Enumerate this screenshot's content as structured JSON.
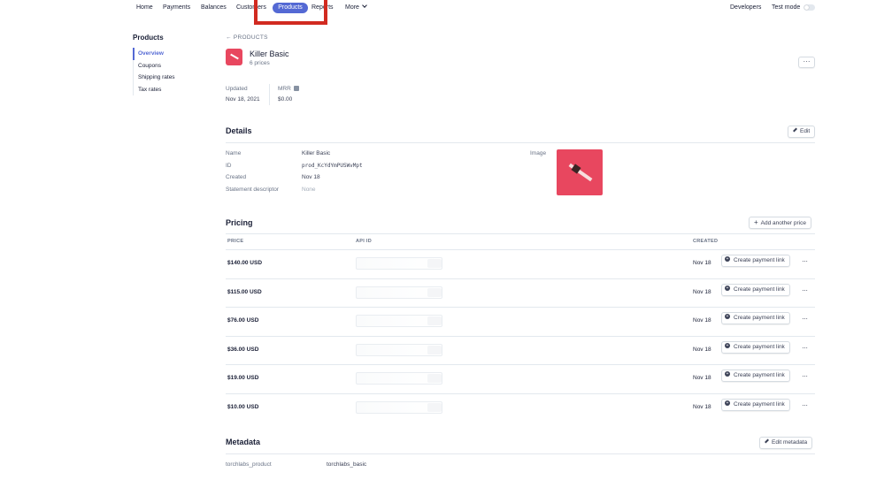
{
  "nav": {
    "items": [
      "Home",
      "Payments",
      "Balances",
      "Customers",
      "Products",
      "Reports",
      "More"
    ],
    "developers": "Developers",
    "test_mode": "Test mode"
  },
  "sidebar": {
    "title": "Products",
    "items": [
      {
        "label": "Overview",
        "active": true
      },
      {
        "label": "Coupons",
        "active": false
      },
      {
        "label": "Shipping rates",
        "active": false
      },
      {
        "label": "Tax rates",
        "active": false
      }
    ]
  },
  "product": {
    "back_label": "← PRODUCTS",
    "name": "Killer Basic",
    "prices_count": "6 prices",
    "more": "···",
    "updated_label": "Updated",
    "updated_value": "Nov 18, 2021",
    "mrr_label": "MRR",
    "mrr_value": "$0.00"
  },
  "details": {
    "title": "Details",
    "edit_label": "Edit",
    "name_label": "Name",
    "name_value": "Killer Basic",
    "id_label": "ID",
    "id_value": "prod_KcYdYmPUSWvMpt",
    "created_label": "Created",
    "created_value": "Nov 18",
    "descriptor_label": "Statement descriptor",
    "descriptor_value": "None",
    "image_label": "Image"
  },
  "pricing": {
    "title": "Pricing",
    "add_label": "Add another price",
    "headers": {
      "price": "PRICE",
      "api_id": "API ID",
      "created": "CREATED"
    },
    "link_label": "Create payment link",
    "row_more": "···",
    "rows": [
      {
        "price": "$140.00 USD",
        "created": "Nov 18"
      },
      {
        "price": "$115.00 USD",
        "created": "Nov 18"
      },
      {
        "price": "$76.00 USD",
        "created": "Nov 18"
      },
      {
        "price": "$36.00 USD",
        "created": "Nov 18"
      },
      {
        "price": "$19.00 USD",
        "created": "Nov 18"
      },
      {
        "price": "$10.00 USD",
        "created": "Nov 18"
      }
    ]
  },
  "metadata": {
    "title": "Metadata",
    "edit_label": "Edit metadata",
    "key": "torchlabs_product",
    "value": "torchlabs_basic"
  },
  "colors": {
    "accent": "#5469d4",
    "product_red": "#e8475f",
    "highlight_red": "#d12a20"
  }
}
